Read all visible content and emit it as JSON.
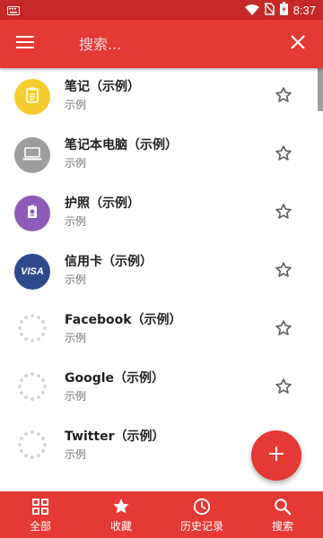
{
  "status_bar": {
    "time": "8:37",
    "icons": [
      "keyboard-icon",
      "wifi-icon",
      "no-sim-icon",
      "battery-icon"
    ]
  },
  "app_bar": {
    "menu_icon": "menu-icon",
    "search_placeholder": "搜索...",
    "close_icon": "close-icon"
  },
  "items": [
    {
      "title": "笔记（示例）",
      "subtitle": "示例",
      "icon": "note-icon",
      "avatar_color": "#f5cd2e"
    },
    {
      "title": "笔记本电脑（示例）",
      "subtitle": "示例",
      "icon": "laptop-icon",
      "avatar_color": "#9e9e9e"
    },
    {
      "title": "护照（示例）",
      "subtitle": "示例",
      "icon": "passport-icon",
      "avatar_color": "#8e5bb8"
    },
    {
      "title": "信用卡（示例）",
      "subtitle": "示例",
      "icon": "visa-icon",
      "avatar_color": "#2f4a8c",
      "avatar_text": "VISA"
    },
    {
      "title": "Facebook（示例）",
      "subtitle": "示例",
      "icon": "loading-icon"
    },
    {
      "title": "Google（示例）",
      "subtitle": "示例",
      "icon": "loading-icon"
    },
    {
      "title": "Twitter（示例）",
      "subtitle": "示例",
      "icon": "loading-icon"
    }
  ],
  "fab": {
    "icon": "plus-icon"
  },
  "bottom_nav": [
    {
      "label": "全部",
      "icon": "grid-icon"
    },
    {
      "label": "收藏",
      "icon": "star-filled-icon"
    },
    {
      "label": "历史记录",
      "icon": "clock-icon"
    },
    {
      "label": "搜索",
      "icon": "search-icon"
    }
  ],
  "colors": {
    "primary": "#e53935",
    "status_bar": "#c62828",
    "text_primary": "#212121",
    "text_secondary": "#757575",
    "star_outline": "#616161"
  }
}
